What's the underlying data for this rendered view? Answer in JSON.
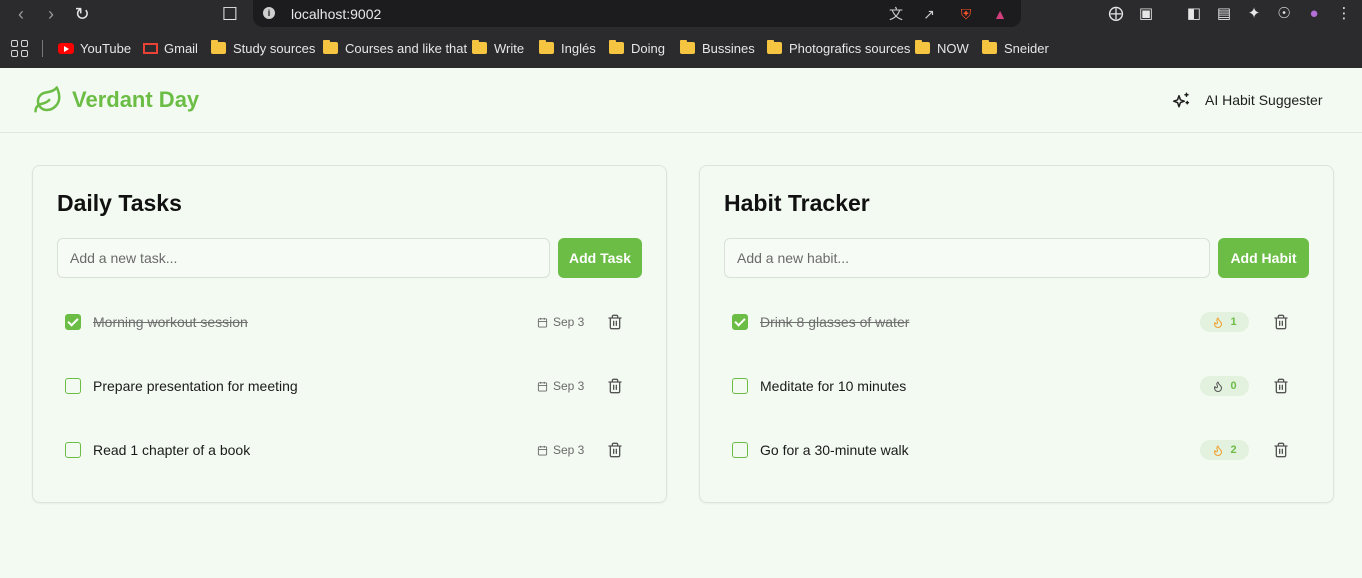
{
  "browser": {
    "url": "localhost:9002",
    "bookmarks": [
      {
        "label": "YouTube",
        "icon": "youtube-icon"
      },
      {
        "label": "Gmail",
        "icon": "gmail-icon"
      },
      {
        "label": "Study sources",
        "icon": "folder-icon"
      },
      {
        "label": "Courses and like that",
        "icon": "folder-icon"
      },
      {
        "label": "Write",
        "icon": "folder-icon"
      },
      {
        "label": "Inglés",
        "icon": "folder-icon"
      },
      {
        "label": "Doing",
        "icon": "folder-icon"
      },
      {
        "label": "Bussines",
        "icon": "folder-icon"
      },
      {
        "label": "Photografics sources",
        "icon": "folder-icon"
      },
      {
        "label": "NOW",
        "icon": "folder-icon"
      },
      {
        "label": "Sneider",
        "icon": "folder-icon"
      }
    ]
  },
  "app": {
    "title": "Verdant Day",
    "ai_button_label": "AI Habit Suggester",
    "accent_color": "#6cbd45"
  },
  "tasks": {
    "title": "Daily Tasks",
    "input_placeholder": "Add a new task...",
    "add_label": "Add Task",
    "items": [
      {
        "label": "Morning workout session",
        "done": true,
        "date": "Sep 3"
      },
      {
        "label": "Prepare presentation for meeting",
        "done": false,
        "date": "Sep 3"
      },
      {
        "label": "Read 1 chapter of a book",
        "done": false,
        "date": "Sep 3"
      }
    ]
  },
  "habits": {
    "title": "Habit Tracker",
    "input_placeholder": "Add a new habit...",
    "add_label": "Add Habit",
    "items": [
      {
        "label": "Drink 8 glasses of water",
        "done": true,
        "streak": "1"
      },
      {
        "label": "Meditate for 10 minutes",
        "done": false,
        "streak": "0"
      },
      {
        "label": "Go for a 30-minute walk",
        "done": false,
        "streak": "2"
      }
    ]
  }
}
